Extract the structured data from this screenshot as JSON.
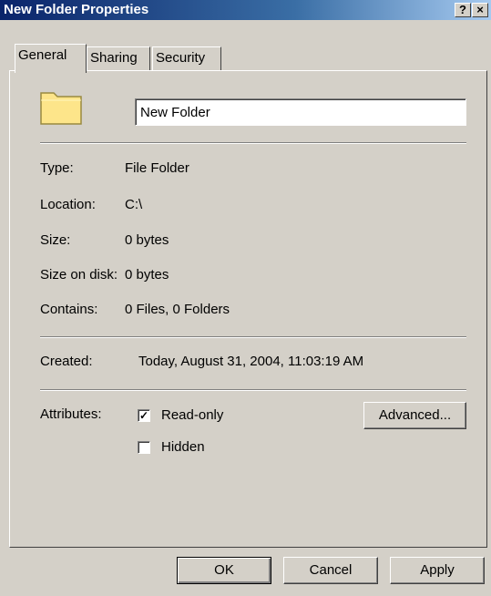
{
  "window": {
    "title": "New Folder Properties",
    "help_glyph": "?",
    "close_glyph": "×"
  },
  "tabs": [
    {
      "label": "General"
    },
    {
      "label": "Sharing"
    },
    {
      "label": "Security"
    }
  ],
  "general": {
    "name_value": "New Folder",
    "rows": [
      {
        "label": "Type:",
        "value": "File Folder"
      },
      {
        "label": "Location:",
        "value": "C:\\"
      },
      {
        "label": "Size:",
        "value": "0 bytes"
      },
      {
        "label": "Size on disk:",
        "value": "0 bytes"
      },
      {
        "label": "Contains:",
        "value": "0 Files, 0 Folders"
      }
    ],
    "created": {
      "label": "Created:",
      "value": "Today, August 31, 2004, 11:03:19 AM"
    },
    "attributes": {
      "label": "Attributes:",
      "readonly": {
        "label": "Read-only",
        "checked": true,
        "mark": "✓"
      },
      "hidden": {
        "label": "Hidden",
        "checked": false,
        "mark": ""
      },
      "advanced_label": "Advanced..."
    }
  },
  "buttons": {
    "ok": "OK",
    "cancel": "Cancel",
    "apply": "Apply"
  },
  "icons": {
    "folder": "folder-icon"
  },
  "colors": {
    "titlebar_start": "#0a246a",
    "titlebar_end": "#a6caf0",
    "face": "#d4d0c8",
    "folder": "#fde58a"
  }
}
